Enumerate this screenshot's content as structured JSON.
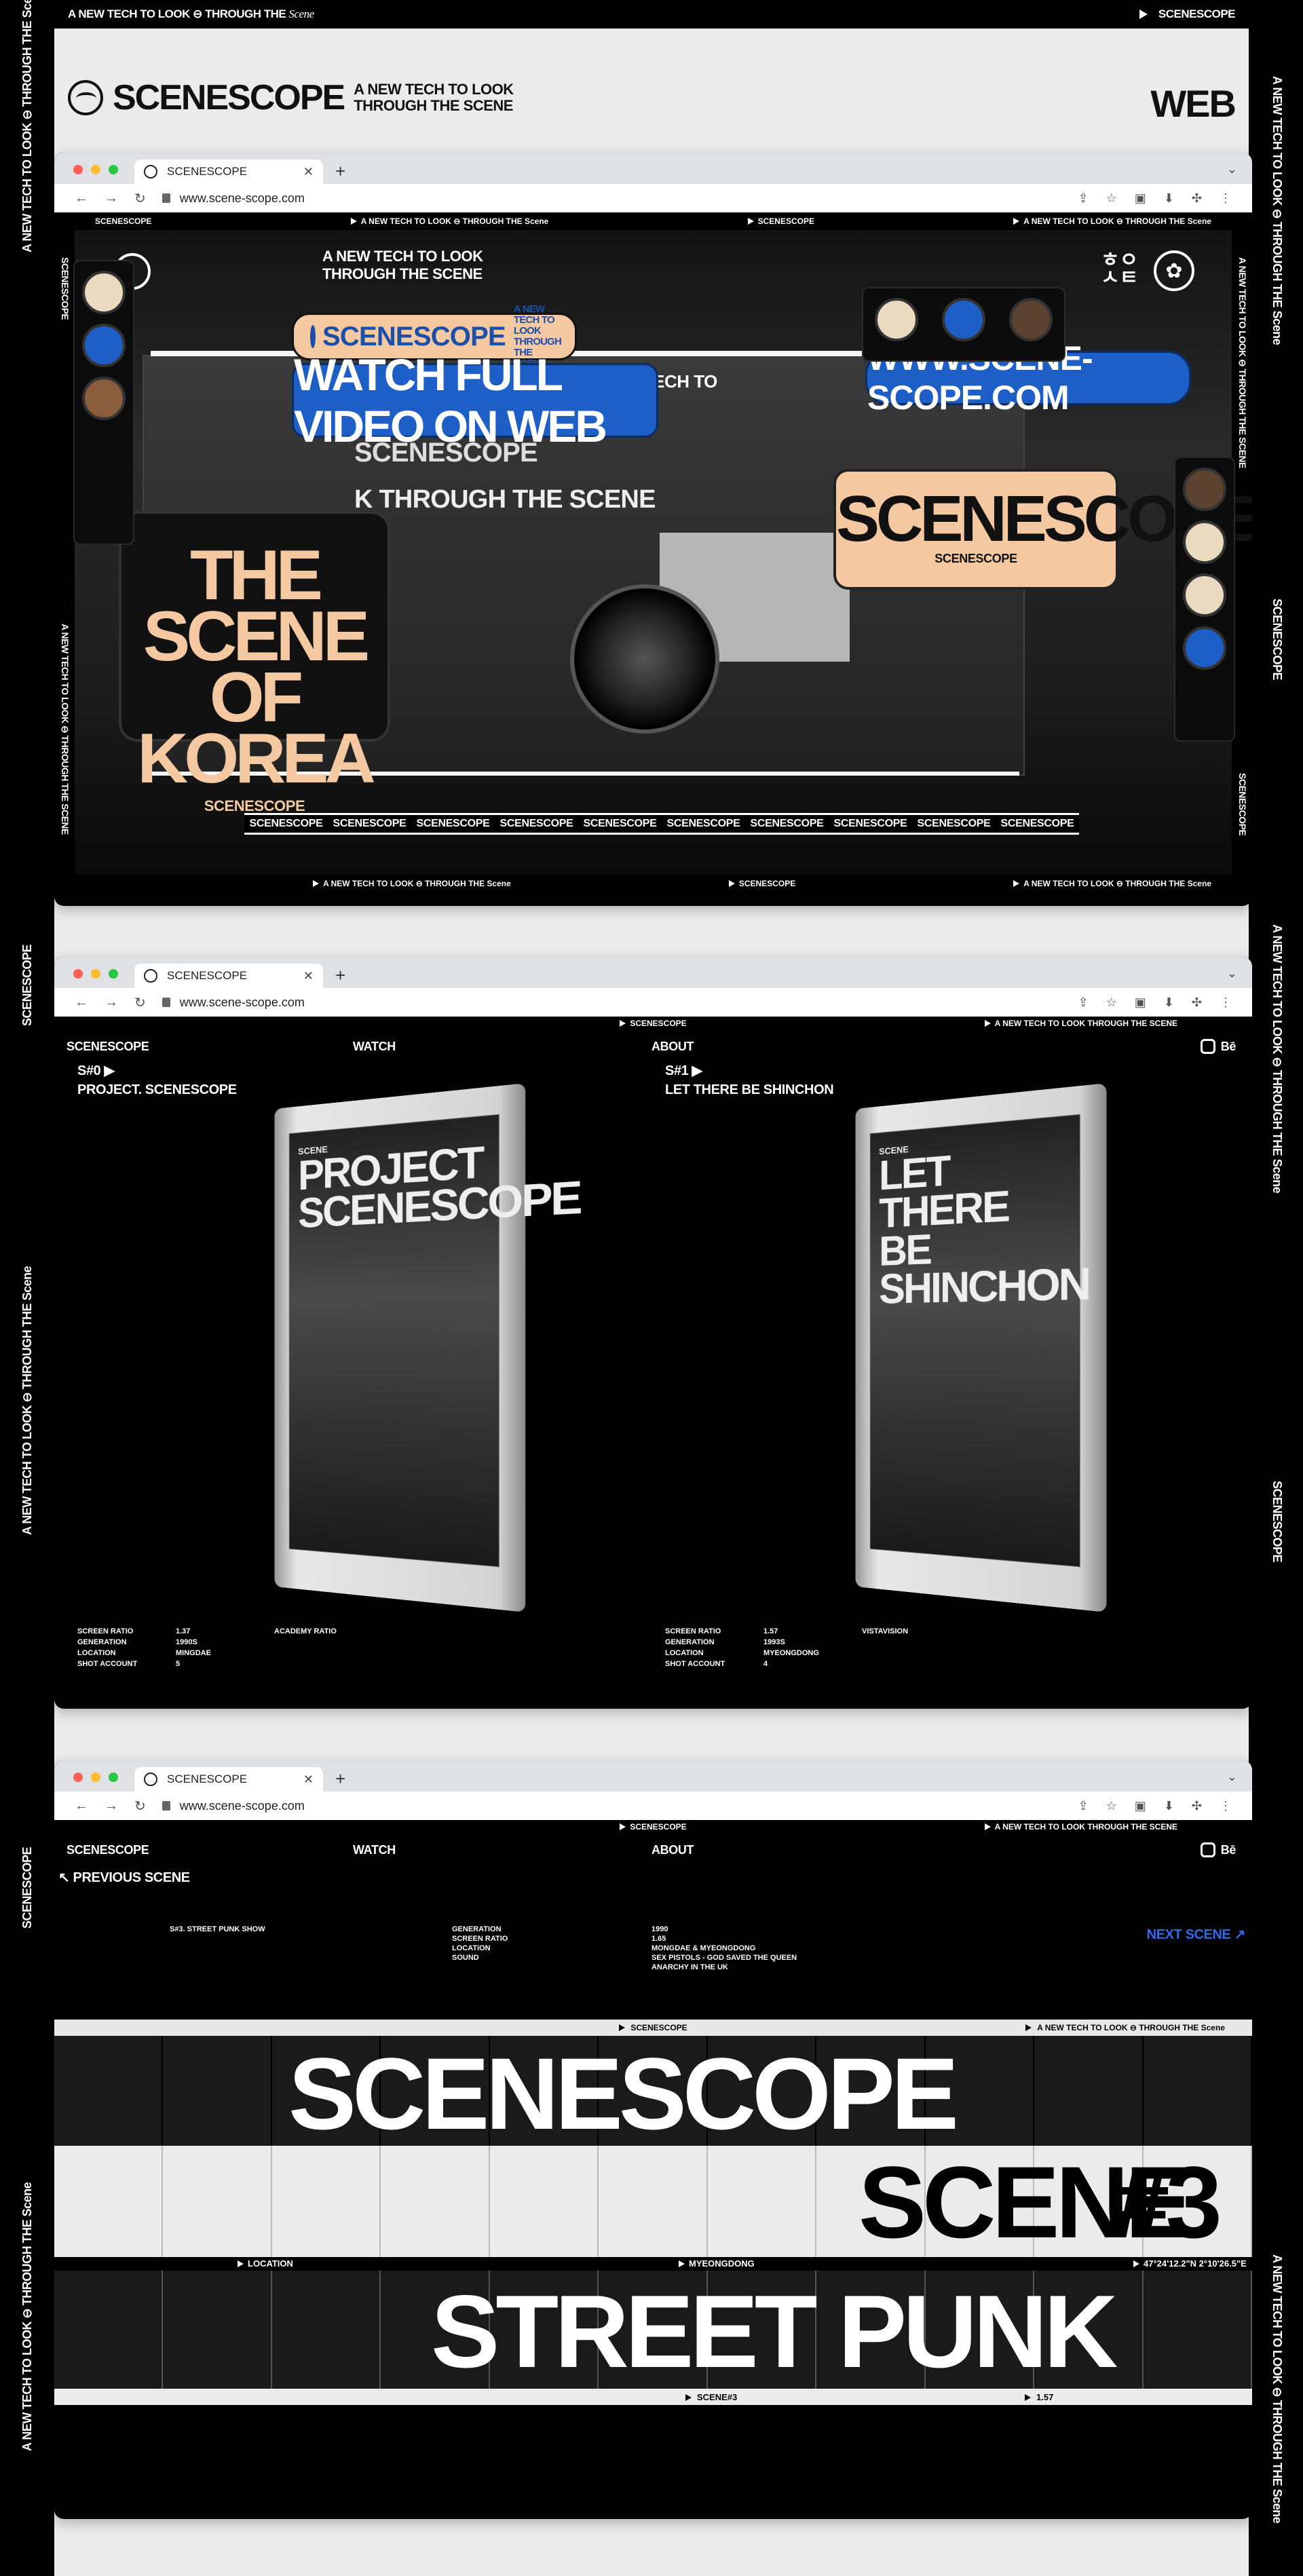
{
  "frame": {
    "top_left": "A NEW TECH TO LOOK ⊖ THROUGH THE",
    "top_left_script": "Scene",
    "top_right": "SCENESCOPE",
    "side_tagline": "A NEW TECH TO LOOK ⊖ THROUGH THE Scene",
    "side_brand": "SCENESCOPE"
  },
  "header": {
    "brand": "SCENESCOPE",
    "tagline_1": "A NEW TECH TO LOOK",
    "tagline_2": "THROUGH THE SCENE",
    "category": "WEB"
  },
  "browser": {
    "tab_title": "SCENESCOPE",
    "url": "www.scene-scope.com",
    "colors": {
      "close": "#ff5f57",
      "min": "#febc2e",
      "max": "#28c840"
    }
  },
  "hero": {
    "strip_left": "SCENESCOPE",
    "strip_items": [
      "A NEW TECH TO LOOK ⊖ THROUGH THE Scene",
      "SCENESCOPE",
      "A NEW TECH TO LOOK ⊖ THROUGH THE Scene"
    ],
    "tagline_1": "A NEW TECH TO LOOK",
    "tagline_2": "THROUGH THE SCENE",
    "pill_brand": "SCENESCOPE",
    "pill_sub_1": "A NEW TECH TO LOOK",
    "pill_sub_2": "THROUGH THE SCENE",
    "watch_cta": "WATCH FULL VIDEO ON WEB",
    "site_url": "WWW.SCENE-SCOPE.COM",
    "sign_text": "A NEW TECH TO",
    "sign_brand": "SCENESCOPE",
    "sign_row_2": "K THROUGH THE SCENE",
    "korea_title_1": "THE SCENE",
    "korea_title_2": "OF KOREA",
    "korea_footer": "SCENESCOPE",
    "card_brand": "SCENESCOPE",
    "card_footer": "SCENESCOPE",
    "ticker": [
      "SCENESCOPE",
      "SCENESCOPE",
      "SCENESCOPE",
      "SCENESCOPE",
      "SCENESCOPE",
      "SCENESCOPE",
      "SCENESCOPE",
      "SCENESCOPE",
      "SCENESCOPE",
      "SCENESCOPE"
    ],
    "side_vertical": "SCENESCOPE",
    "side_vertical_2": "A NEW TECH TO LOOK ⊖ THROUGH THE SCENE",
    "bottom_items": [
      "A NEW TECH TO LOOK ⊖ THROUGH THE Scene",
      "SCENESCOPE",
      "A NEW TECH TO LOOK ⊖ THROUGH THE Scene"
    ]
  },
  "scenes_page": {
    "strip_center": "SCENESCOPE",
    "strip_right": "A NEW TECH TO LOOK THROUGH THE SCENE",
    "nav": {
      "brand": "SCENESCOPE",
      "watch": "WATCH",
      "about": "ABOUT",
      "social": "Bē"
    },
    "left": {
      "number": "S#0",
      "title": "PROJECT. SCENESCOPE",
      "dvd_label": "SCENE",
      "dvd_title": "PROJECT SCENESCOPE",
      "specs": [
        [
          "SCREEN RATIO",
          "1.37",
          "ACADEMY RATIO"
        ],
        [
          "GENERATION",
          "1990S",
          ""
        ],
        [
          "LOCATION",
          "MINGDAE",
          ""
        ],
        [
          "SHOT ACCOUNT",
          "5",
          ""
        ]
      ]
    },
    "right": {
      "number": "S#1",
      "title": "LET THERE BE SHINCHON",
      "dvd_label": "SCENE",
      "dvd_title": "LET THERE BE SHINCHON",
      "specs": [
        [
          "SCREEN RATIO",
          "1.57",
          "VISTAVISION"
        ],
        [
          "GENERATION",
          "1993S",
          ""
        ],
        [
          "LOCATION",
          "MYEONGDONG",
          ""
        ],
        [
          "SHOT ACCOUNT",
          "4",
          ""
        ]
      ]
    }
  },
  "scene_detail": {
    "prev": "PREVIOUS SCENE",
    "next": "NEXT SCENE",
    "scene_id": "S#3. STREET PUNK SHOW",
    "fields": [
      "GENERATION",
      "SCREEN RATIO",
      "LOCATION",
      "SOUND"
    ],
    "values": [
      "1990",
      "1.65",
      "MONGDAE & MYEONGDONG",
      "SEX PISTOLS - GOD SAVED THE QUEEN",
      "ANARCHY IN THE UK"
    ],
    "band_strip_center": "SCENESCOPE",
    "band_strip_right": "A NEW TECH TO LOOK ⊖ THROUGH THE Scene",
    "band_1": "SCENESCOPE",
    "band_2a": "SCENE",
    "band_2b": "#3",
    "labels": {
      "location": "LOCATION",
      "place": "MYEONGDONG",
      "coords": "47°24'12.2\"N 2°10'26.5\"E"
    },
    "band_3": "STREET PUNK SHOW",
    "foot_left": "SCENE#3",
    "foot_right": "1.57"
  }
}
